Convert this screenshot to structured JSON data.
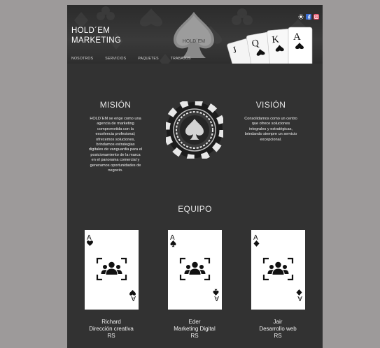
{
  "header": {
    "brand_line1": "HOLD´EM",
    "brand_line2": "MARKETING",
    "logo_text": "HOLD´EM",
    "nav": [
      "NOSOTROS",
      "SERVICIOS",
      "PAQUETES",
      "TRABAJOS"
    ],
    "card_letters": [
      "J",
      "Q",
      "K",
      "A"
    ]
  },
  "social_icons": [
    "sun-icon",
    "facebook-icon",
    "instagram-icon"
  ],
  "mission": {
    "title": "MISIÓN",
    "lines": [
      "HOLD´EM se erige como una",
      "agencia de marketing",
      "comprometida con la",
      "excelencia profesional;",
      "ofrecemos soluciones,",
      "brindamos estrategias",
      "digitales de vanguardia para el",
      "posicionamiento de la marca",
      "en el panorama comercial y",
      "generamos oportunidades de",
      "negocio."
    ]
  },
  "vision": {
    "title": "VISIÓN",
    "lines": [
      "Consolidamos como un centro",
      "que ofrece soluciones",
      "integrales y estratégicas,",
      "brindando siempre un servicio",
      "excepcional."
    ]
  },
  "team": {
    "title": "EQUIPO",
    "members": [
      {
        "name": "Richard",
        "role": "Dirección creativa",
        "initials": "RS",
        "suit": "heart"
      },
      {
        "name": "Eder",
        "role": "Marketing Digital",
        "initials": "RS",
        "suit": "spade"
      },
      {
        "name": "Jair",
        "role": "Desarrollo web",
        "initials": "RS",
        "suit": "diamond"
      }
    ],
    "card_rank": "A"
  },
  "colors": {
    "page_bg": "#9d9a9a",
    "panel_bg": "#323232",
    "text": "#e6e6e6",
    "instagram": "#e0405a",
    "facebook": "#3b6fd6"
  }
}
